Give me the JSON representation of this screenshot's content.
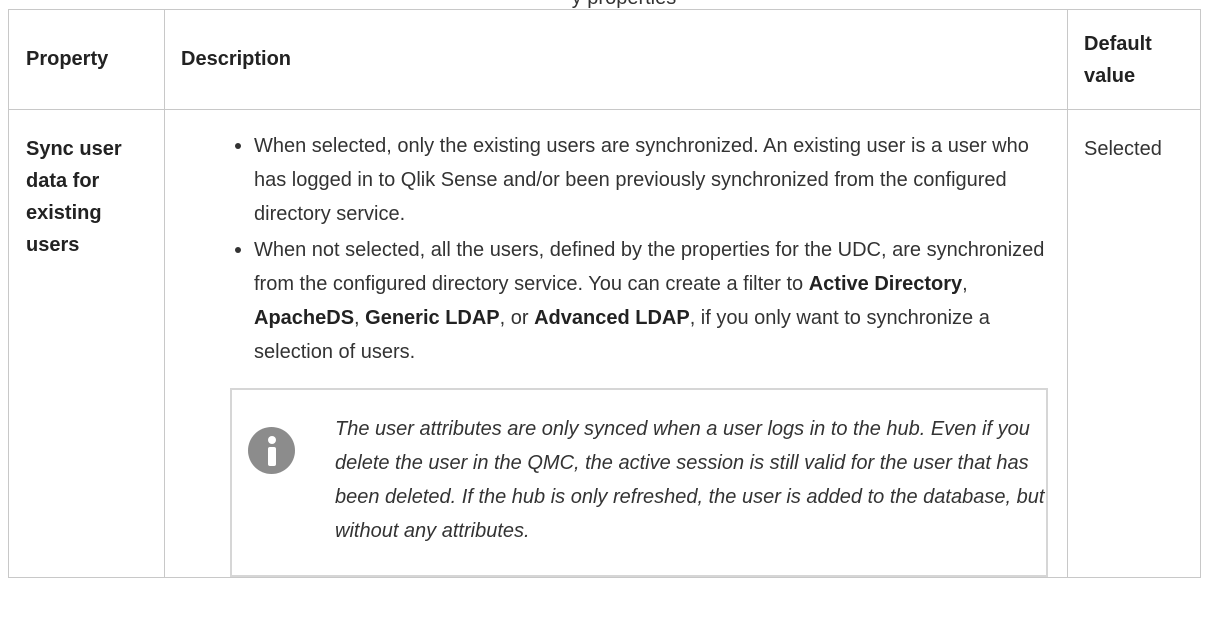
{
  "caption": "y properties",
  "table": {
    "headers": {
      "property": "Property",
      "description": "Description",
      "default_line1": "Default",
      "default_line2": "value"
    },
    "rows": [
      {
        "property_lines": [
          "Sync user",
          "data for",
          "existing",
          "users"
        ],
        "bullets": [
          {
            "text": "When selected, only the existing users are synchronized. An existing user is a user who has logged in to Qlik Sense and/or been previously synchronized from the configured directory service."
          },
          {
            "t1": "When not selected, all the users, defined by the properties for the UDC, are synchronized from the configured directory service. You can create a filter to ",
            "b1": "Active Directory",
            "t2": ", ",
            "b2": "ApacheDS",
            "t3": ", ",
            "b3": "Generic LDAP",
            "t4": ", or ",
            "b4": "Advanced LDAP",
            "t5": ", if you only want to synchronize a selection of users."
          }
        ],
        "note": {
          "icon": "info-icon",
          "text": "The user attributes are only synced when a user logs in to the hub. Even if you delete the user in the QMC, the active session is still valid for the user that has been deleted. If the hub is only refreshed, the user is added to the database, but without any attributes."
        },
        "default_value": "Selected"
      }
    ]
  },
  "colors": {
    "border": "#c8c8c8",
    "note_border": "#d6d6d6",
    "icon": "#8c8c8c",
    "text": "#333333"
  }
}
